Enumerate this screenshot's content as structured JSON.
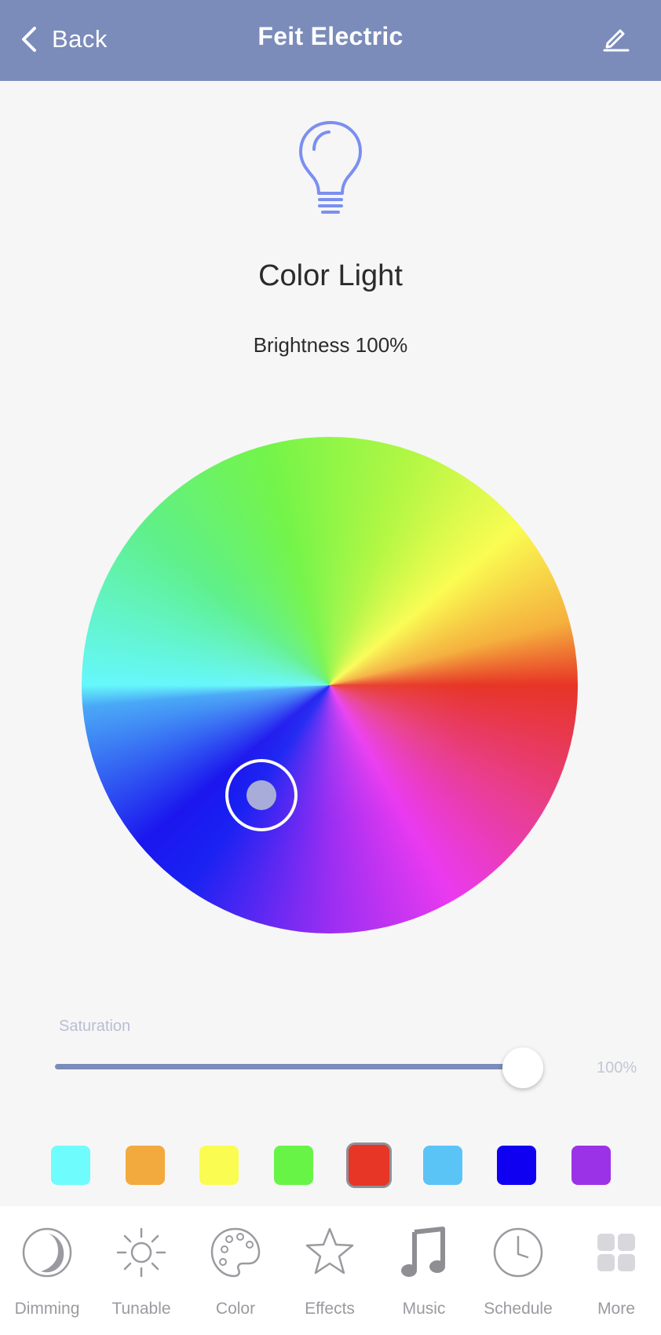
{
  "header": {
    "back_label": "Back",
    "title": "Feit Electric",
    "bg_color": "#7b8cba"
  },
  "device": {
    "icon": "lightbulb-icon",
    "name": "Color Light",
    "brightness_text": "Brightness 100%",
    "brightness": 100
  },
  "color_wheel": {
    "selected_color": "#1a22f2"
  },
  "saturation": {
    "label": "Saturation",
    "value_text": "100%",
    "value": 100
  },
  "swatches": [
    {
      "color": "#6ffcfc",
      "selected": false
    },
    {
      "color": "#f2a93d",
      "selected": false
    },
    {
      "color": "#fbfc52",
      "selected": false
    },
    {
      "color": "#67f447",
      "selected": false
    },
    {
      "color": "#e73526",
      "selected": true
    },
    {
      "color": "#5bc4f7",
      "selected": false
    },
    {
      "color": "#0f00f2",
      "selected": false
    },
    {
      "color": "#9b32e8",
      "selected": false
    }
  ],
  "nav": [
    {
      "label": "Dimming",
      "icon": "dimming-icon"
    },
    {
      "label": "Tunable",
      "icon": "sun-icon"
    },
    {
      "label": "Color",
      "icon": "palette-icon"
    },
    {
      "label": "Effects",
      "icon": "star-icon"
    },
    {
      "label": "Music",
      "icon": "music-note-icon"
    },
    {
      "label": "Schedule",
      "icon": "clock-icon"
    },
    {
      "label": "More",
      "icon": "grid-icon"
    }
  ]
}
